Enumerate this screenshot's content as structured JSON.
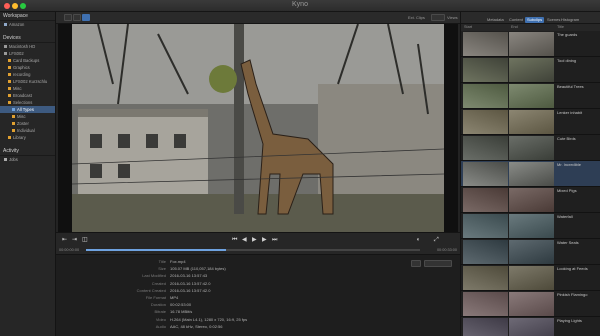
{
  "window": {
    "title": "Kyno"
  },
  "sidebar": {
    "workspace_header": "Workspace",
    "workspace_item": "Amazon",
    "devices_header": "Devices",
    "devices": [
      {
        "label": "Macintosh HD"
      },
      {
        "label": "LFS002"
      },
      {
        "label": "Card Backups"
      },
      {
        "label": "Graphics"
      },
      {
        "label": "recording"
      },
      {
        "label": "LFS002 Kurzschlu"
      },
      {
        "label": "Misc"
      },
      {
        "label": "Broadcast"
      },
      {
        "label": "Selections"
      },
      {
        "label": "All Types"
      },
      {
        "label": "Misc"
      },
      {
        "label": "Zoster"
      },
      {
        "label": "Individual"
      },
      {
        "label": "Library"
      }
    ],
    "activity_header": "Activity",
    "activity_item": "Jobs"
  },
  "toolbar": {
    "filter_label": "Ext. Clips",
    "view_label": "Views"
  },
  "right_panel": {
    "tabs": [
      {
        "label": "Metadata"
      },
      {
        "label": "Content"
      },
      {
        "label": "Subclips"
      },
      {
        "label": "Scenes"
      },
      {
        "label": "Histogram"
      }
    ],
    "active_tab": 2,
    "columns": {
      "start": "Start",
      "end": "End",
      "title": "Title"
    },
    "rows": [
      {
        "title": "The guards"
      },
      {
        "title": "Tool dining"
      },
      {
        "title": "Beautiful Trees"
      },
      {
        "title": "Lenker inhabit"
      },
      {
        "title": "Cute Birds"
      },
      {
        "title": "Mr. Incredible"
      },
      {
        "title": "Mixed Pigs"
      },
      {
        "title": "Waterfall"
      },
      {
        "title": "Water Seals"
      },
      {
        "title": "Looking at Feeds"
      },
      {
        "title": "Pinkish Flamingo"
      },
      {
        "title": "Playing Lights"
      }
    ],
    "selected_row": 5
  },
  "player": {
    "timecode_in": "00:00:00:00",
    "timecode_out": "00:00:33:00",
    "progress": 0.42
  },
  "info": {
    "rows": [
      {
        "key": "Title",
        "value": "Fox.mp4"
      },
      {
        "key": "Size",
        "value": "105.07 MB (110,057,184 bytes)"
      },
      {
        "key": "Last Modified",
        "value": "2016-03-16 13:57:43"
      },
      {
        "key": "Created",
        "value": "2016-03-16 13:57:42.0"
      },
      {
        "key": "Content Created",
        "value": "2016-03-16 13:57:42.0"
      },
      {
        "key": "File Format",
        "value": "MP4"
      },
      {
        "key": "Duration",
        "value": "00:02:53:00"
      },
      {
        "key": "Bitrate",
        "value": "16.78 MBit/s"
      },
      {
        "key": "Video",
        "value": "H.264 (Main L4.1), 1280 x 720, 16:9, 25 fps"
      },
      {
        "key": "Audio",
        "value": "AAC, 48 kHz, Stereo, 0:02:56"
      }
    ]
  }
}
